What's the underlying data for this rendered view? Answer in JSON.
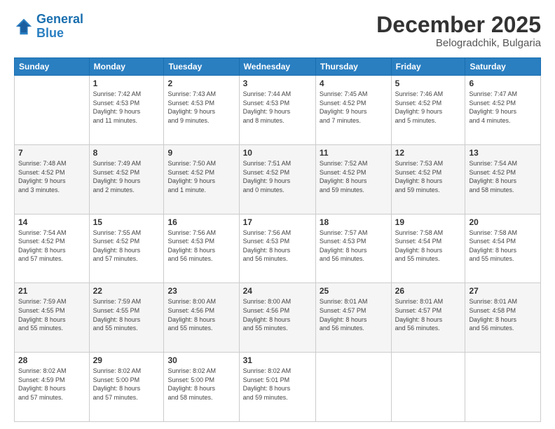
{
  "header": {
    "logo_line1": "General",
    "logo_line2": "Blue",
    "month": "December 2025",
    "location": "Belogradchik, Bulgaria"
  },
  "weekdays": [
    "Sunday",
    "Monday",
    "Tuesday",
    "Wednesday",
    "Thursday",
    "Friday",
    "Saturday"
  ],
  "weeks": [
    [
      {
        "day": "",
        "info": ""
      },
      {
        "day": "1",
        "info": "Sunrise: 7:42 AM\nSunset: 4:53 PM\nDaylight: 9 hours\nand 11 minutes."
      },
      {
        "day": "2",
        "info": "Sunrise: 7:43 AM\nSunset: 4:53 PM\nDaylight: 9 hours\nand 9 minutes."
      },
      {
        "day": "3",
        "info": "Sunrise: 7:44 AM\nSunset: 4:53 PM\nDaylight: 9 hours\nand 8 minutes."
      },
      {
        "day": "4",
        "info": "Sunrise: 7:45 AM\nSunset: 4:52 PM\nDaylight: 9 hours\nand 7 minutes."
      },
      {
        "day": "5",
        "info": "Sunrise: 7:46 AM\nSunset: 4:52 PM\nDaylight: 9 hours\nand 5 minutes."
      },
      {
        "day": "6",
        "info": "Sunrise: 7:47 AM\nSunset: 4:52 PM\nDaylight: 9 hours\nand 4 minutes."
      }
    ],
    [
      {
        "day": "7",
        "info": "Sunrise: 7:48 AM\nSunset: 4:52 PM\nDaylight: 9 hours\nand 3 minutes."
      },
      {
        "day": "8",
        "info": "Sunrise: 7:49 AM\nSunset: 4:52 PM\nDaylight: 9 hours\nand 2 minutes."
      },
      {
        "day": "9",
        "info": "Sunrise: 7:50 AM\nSunset: 4:52 PM\nDaylight: 9 hours\nand 1 minute."
      },
      {
        "day": "10",
        "info": "Sunrise: 7:51 AM\nSunset: 4:52 PM\nDaylight: 9 hours\nand 0 minutes."
      },
      {
        "day": "11",
        "info": "Sunrise: 7:52 AM\nSunset: 4:52 PM\nDaylight: 8 hours\nand 59 minutes."
      },
      {
        "day": "12",
        "info": "Sunrise: 7:53 AM\nSunset: 4:52 PM\nDaylight: 8 hours\nand 59 minutes."
      },
      {
        "day": "13",
        "info": "Sunrise: 7:54 AM\nSunset: 4:52 PM\nDaylight: 8 hours\nand 58 minutes."
      }
    ],
    [
      {
        "day": "14",
        "info": "Sunrise: 7:54 AM\nSunset: 4:52 PM\nDaylight: 8 hours\nand 57 minutes."
      },
      {
        "day": "15",
        "info": "Sunrise: 7:55 AM\nSunset: 4:52 PM\nDaylight: 8 hours\nand 57 minutes."
      },
      {
        "day": "16",
        "info": "Sunrise: 7:56 AM\nSunset: 4:53 PM\nDaylight: 8 hours\nand 56 minutes."
      },
      {
        "day": "17",
        "info": "Sunrise: 7:56 AM\nSunset: 4:53 PM\nDaylight: 8 hours\nand 56 minutes."
      },
      {
        "day": "18",
        "info": "Sunrise: 7:57 AM\nSunset: 4:53 PM\nDaylight: 8 hours\nand 56 minutes."
      },
      {
        "day": "19",
        "info": "Sunrise: 7:58 AM\nSunset: 4:54 PM\nDaylight: 8 hours\nand 55 minutes."
      },
      {
        "day": "20",
        "info": "Sunrise: 7:58 AM\nSunset: 4:54 PM\nDaylight: 8 hours\nand 55 minutes."
      }
    ],
    [
      {
        "day": "21",
        "info": "Sunrise: 7:59 AM\nSunset: 4:55 PM\nDaylight: 8 hours\nand 55 minutes."
      },
      {
        "day": "22",
        "info": "Sunrise: 7:59 AM\nSunset: 4:55 PM\nDaylight: 8 hours\nand 55 minutes."
      },
      {
        "day": "23",
        "info": "Sunrise: 8:00 AM\nSunset: 4:56 PM\nDaylight: 8 hours\nand 55 minutes."
      },
      {
        "day": "24",
        "info": "Sunrise: 8:00 AM\nSunset: 4:56 PM\nDaylight: 8 hours\nand 55 minutes."
      },
      {
        "day": "25",
        "info": "Sunrise: 8:01 AM\nSunset: 4:57 PM\nDaylight: 8 hours\nand 56 minutes."
      },
      {
        "day": "26",
        "info": "Sunrise: 8:01 AM\nSunset: 4:57 PM\nDaylight: 8 hours\nand 56 minutes."
      },
      {
        "day": "27",
        "info": "Sunrise: 8:01 AM\nSunset: 4:58 PM\nDaylight: 8 hours\nand 56 minutes."
      }
    ],
    [
      {
        "day": "28",
        "info": "Sunrise: 8:02 AM\nSunset: 4:59 PM\nDaylight: 8 hours\nand 57 minutes."
      },
      {
        "day": "29",
        "info": "Sunrise: 8:02 AM\nSunset: 5:00 PM\nDaylight: 8 hours\nand 57 minutes."
      },
      {
        "day": "30",
        "info": "Sunrise: 8:02 AM\nSunset: 5:00 PM\nDaylight: 8 hours\nand 58 minutes."
      },
      {
        "day": "31",
        "info": "Sunrise: 8:02 AM\nSunset: 5:01 PM\nDaylight: 8 hours\nand 59 minutes."
      },
      {
        "day": "",
        "info": ""
      },
      {
        "day": "",
        "info": ""
      },
      {
        "day": "",
        "info": ""
      }
    ]
  ]
}
